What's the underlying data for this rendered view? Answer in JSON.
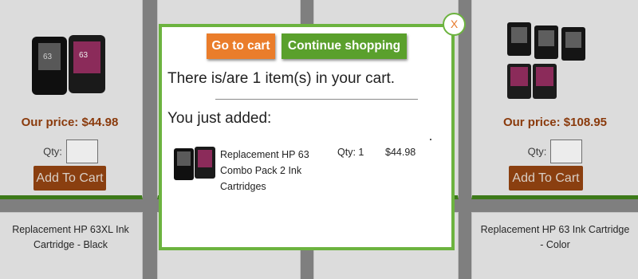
{
  "colors": {
    "accent_green": "#6cb33f",
    "go_to_cart": "#ea7d2b",
    "continue_shopping": "#5aa02c",
    "price": "#8a3a0c",
    "add_to_cart": "#8a3f10"
  },
  "products": [
    {
      "price": "Our price: $44.98",
      "qty_label": "Qty:",
      "button": "Add To Cart",
      "image": "ink-cartridge-combo-icon"
    },
    {
      "price": "Our price: $108.95",
      "qty_label": "Qty:",
      "button": "Add To Cart",
      "image": "ink-cartridge-set-icon"
    }
  ],
  "bottom_products": [
    {
      "title": "Replacement HP 63XL Ink Cartridge - Black"
    },
    {
      "title": "Replacement HP 63 Ink Cartridge - Color"
    }
  ],
  "modal": {
    "close_label": "X",
    "go_to_cart": "Go to cart",
    "continue_shopping": "Continue shopping",
    "title": "There is/are 1 item(s) in your cart.",
    "just_added": "You just added:",
    "item": {
      "name": "Replacement HP 63 Combo Pack 2 Ink Cartridges",
      "qty": "Qty: 1",
      "price": "$44.98",
      "image": "ink-cartridge-combo-icon"
    }
  }
}
